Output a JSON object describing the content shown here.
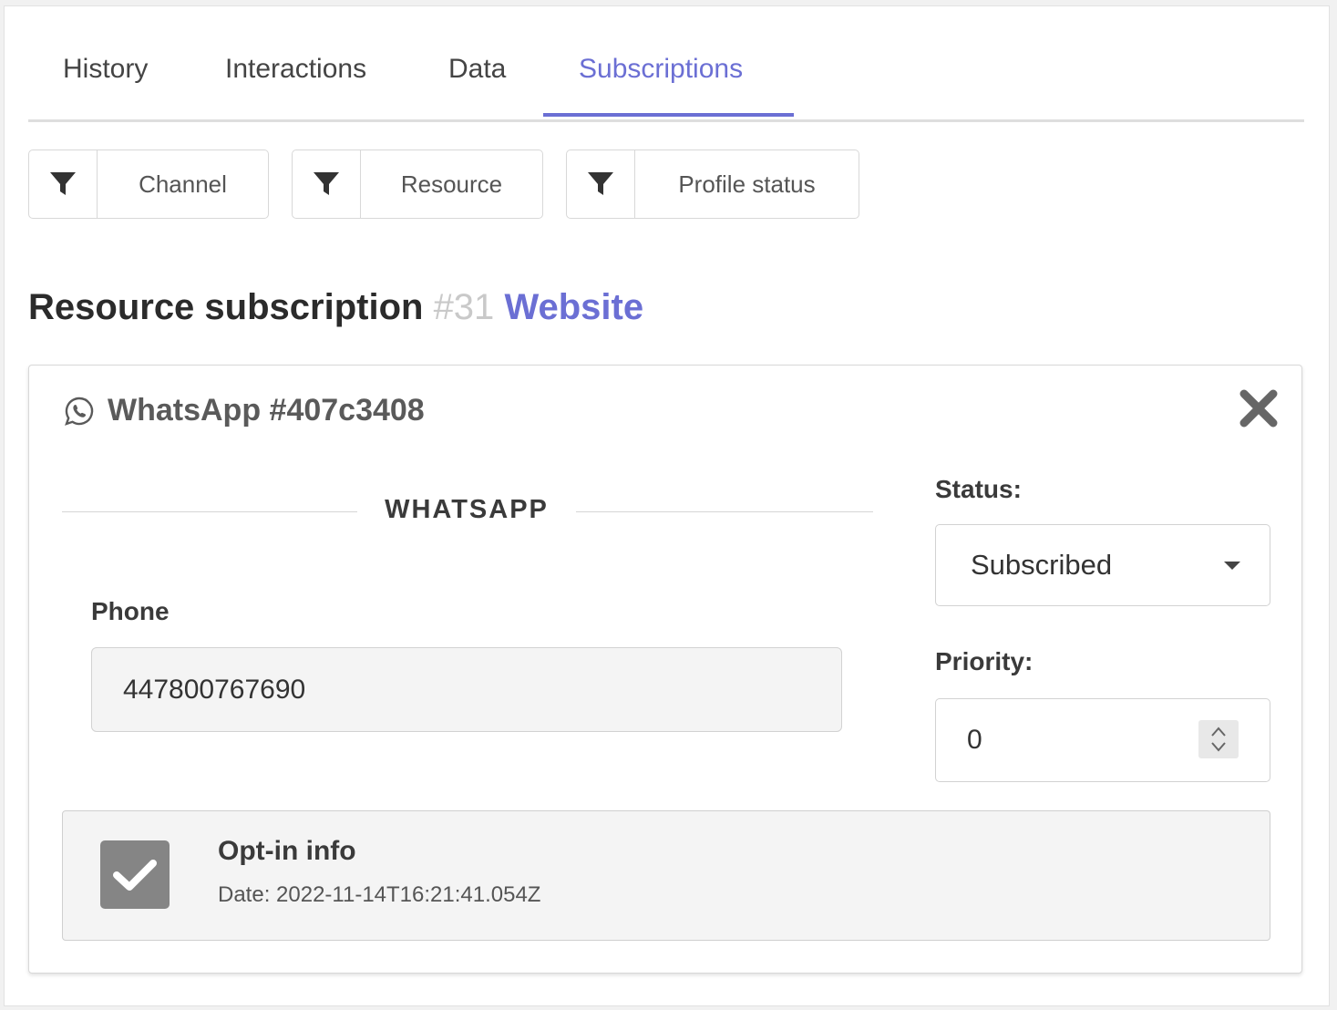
{
  "tabs": [
    {
      "label": "History"
    },
    {
      "label": "Interactions"
    },
    {
      "label": "Data"
    },
    {
      "label": "Subscriptions",
      "active": true
    }
  ],
  "filters": [
    {
      "label": "Channel",
      "icon": "filter-icon"
    },
    {
      "label": "Resource",
      "icon": "filter-icon"
    },
    {
      "label": "Profile status",
      "icon": "filter-icon"
    }
  ],
  "section": {
    "title": "Resource subscription",
    "number": "#31",
    "resource_link": "Website"
  },
  "card": {
    "channel_icon": "whatsapp-icon",
    "title": "WhatsApp #407c3408",
    "close_icon": "close-icon",
    "divider_label": "WHATSAPP",
    "phone_label": "Phone",
    "phone_value": "447800767690",
    "status_label": "Status:",
    "status_value": "Subscribed",
    "priority_label": "Priority:",
    "priority_value": "0",
    "optin": {
      "checked": true,
      "title": "Opt-in info",
      "date": "Date: 2022-11-14T16:21:41.054Z"
    }
  },
  "colors": {
    "accent": "#6b6fd4",
    "text_dark": "#2b2b2b",
    "muted_number": "#c9c9c9",
    "checkbox_bg": "#858585"
  }
}
